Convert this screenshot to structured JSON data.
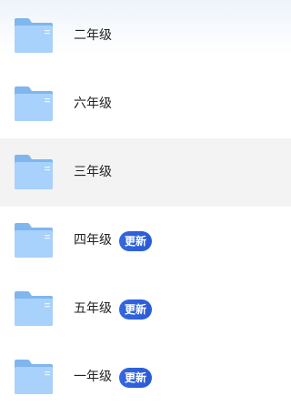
{
  "colors": {
    "folder_back": "#7fb6ee",
    "folder_front": "#a8d1fb",
    "badge_bg": "#2f63dc",
    "selected_row_bg": "#f3f3f3"
  },
  "folders": [
    {
      "name": "二年级",
      "icon": "folder-icon",
      "badge": null,
      "selected": false
    },
    {
      "name": "六年级",
      "icon": "folder-icon",
      "badge": null,
      "selected": false
    },
    {
      "name": "三年级",
      "icon": "folder-icon",
      "badge": null,
      "selected": true
    },
    {
      "name": "四年级",
      "icon": "folder-icon",
      "badge": "更新",
      "selected": false
    },
    {
      "name": "五年级",
      "icon": "folder-icon",
      "badge": "更新",
      "selected": false
    },
    {
      "name": "一年级",
      "icon": "folder-icon",
      "badge": "更新",
      "selected": false
    }
  ]
}
